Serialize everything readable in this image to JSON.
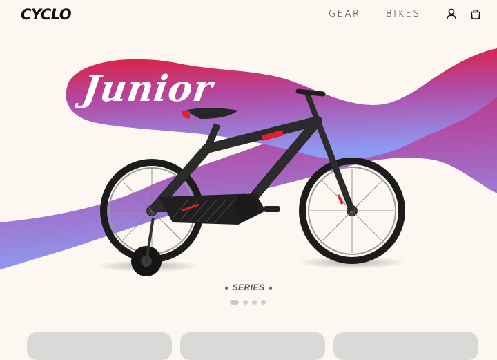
{
  "brand": {
    "name": "CYCLO"
  },
  "nav": {
    "items": [
      "GEAR",
      "BIKES"
    ]
  },
  "header_icons": {
    "account": "user-icon",
    "cart": "shopping-bag-icon"
  },
  "hero": {
    "title": "Junior",
    "series_label": "SERIES",
    "gradient_colors": [
      "#e8172a",
      "#b347a0",
      "#8e9bf5"
    ]
  },
  "carousel": {
    "total_slides": 4,
    "active_index": 0
  },
  "cards": [
    {},
    {},
    {}
  ]
}
